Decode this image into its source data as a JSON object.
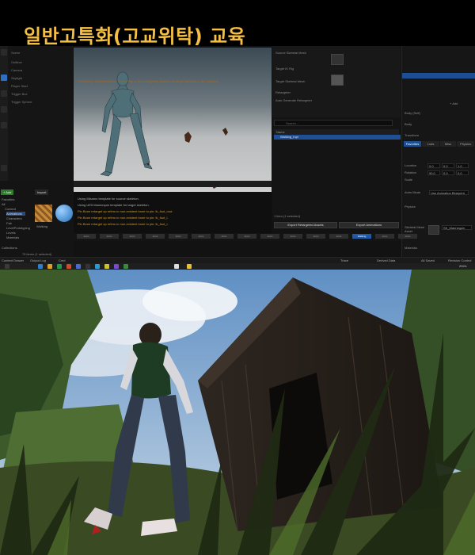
{
  "banner": {
    "title": "일반고특화(고교위탁) 교육"
  },
  "outliner": {
    "items": [
      "Scene",
      "Outliner",
      "Camera",
      "Skylight",
      "Player Start",
      "Trigger Box",
      "Trigger Sphere"
    ]
  },
  "viewport": {
    "hint": "Previewing retargeted pose. Press Play to test retargeting against the target skeleton in the viewport."
  },
  "details": {
    "rows": [
      "Source Skeletal Mesh",
      "Target IK Rig",
      "Target Skeletal Mesh",
      "Retargeter",
      "Auto Generate Retargeter"
    ]
  },
  "asset_list": {
    "search_placeholder": "Search...",
    "header": "Name",
    "row": "Walking_Inpl",
    "selected": "1 item (1 selected)"
  },
  "buttons": {
    "export_retargeted": "Export Retargeted Assets",
    "export_animations": "Export Animations"
  },
  "properties": {
    "add_label": "+ Add",
    "rows": [
      "Body (Self)",
      "Body",
      "Transform",
      "Location",
      "Rotation",
      "Scale",
      "Anim Mode",
      "Physics"
    ],
    "tabs": [
      "Favorites",
      "Lods",
      "Misc",
      "Physics"
    ],
    "values": [
      "0.0",
      "0.0",
      "1.0",
      "90.0",
      "0.0",
      "0.0"
    ],
    "anim_mode": "Use Animation Blueprint",
    "mesh_label": "Skeletal Mesh Asset",
    "mesh_value": "SK_Mannequin",
    "materials": "Materials"
  },
  "content_browser": {
    "tabs": [
      "Content Browser",
      "Output Log"
    ],
    "buttons": [
      "+ Add",
      "Import",
      "Save All"
    ],
    "tree": [
      "Favorites",
      "All",
      "Content",
      "Animations",
      "Characters",
      "Fab",
      "LevelPrototyping",
      "Levels",
      "Materials",
      "Collections"
    ],
    "asset_label": "Walking"
  },
  "output_log": {
    "lines": [
      "Using Mixamo template for source skeleton.",
      "Using UE5 Mannequin template for target skeleton.",
      "Pin Bone retarget op refers to non-existent bone to pin: ik_foot_root.",
      "Pin Bone retarget op refers to non-existent bone to pin: ik_foot_l.",
      "Pin Bone retarget op refers to non-existent bone to pin: ik_foot_r."
    ]
  },
  "strip": {
    "items": [
      "Anim",
      "Anim",
      "Anim",
      "Anim",
      "Anim",
      "Anim",
      "Anim",
      "Anim",
      "Anim",
      "Anim",
      "Anim",
      "Anim",
      "Walking",
      "Anim",
      "Anim"
    ]
  },
  "items_count": "75 items (1 selected)",
  "bottom_bar": {
    "items": [
      "Content Drawer",
      "Output Log",
      "Cmd",
      "Trace",
      "Derived Data",
      "All Saved",
      "Revision Control"
    ]
  },
  "taskbar": {
    "clock": "2024-"
  },
  "colors": {
    "accent_blue": "#1f5aa8",
    "banner_title": "#f3bf44"
  }
}
